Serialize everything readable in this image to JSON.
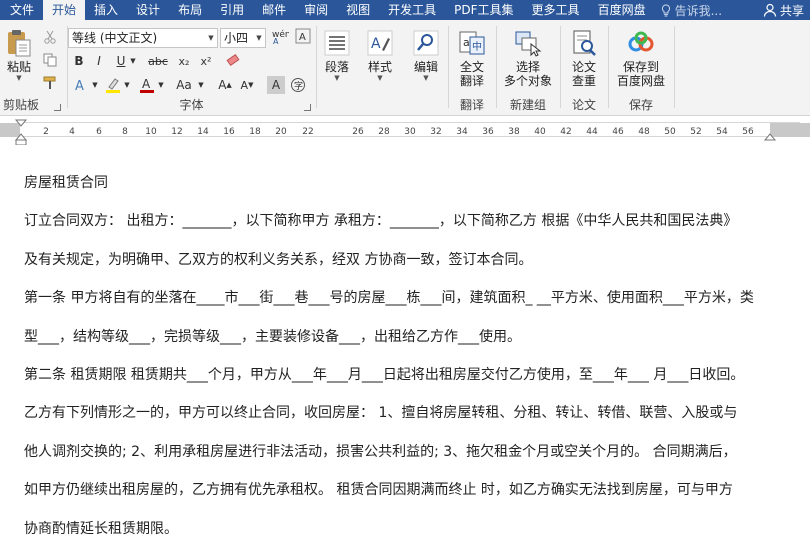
{
  "tabs": [
    "文件",
    "开始",
    "插入",
    "设计",
    "布局",
    "引用",
    "邮件",
    "审阅",
    "视图",
    "开发工具",
    "PDF工具集",
    "更多工具",
    "百度网盘"
  ],
  "active_tab": "开始",
  "tell_me": "告诉我...",
  "share": "共享",
  "clipboard": {
    "paste": "粘贴",
    "label": "剪贴板"
  },
  "font": {
    "name": "等线 (中文正文)",
    "size": "小四",
    "label": "字体"
  },
  "paragraph": {
    "label": "段落"
  },
  "styles": {
    "label": "样式"
  },
  "editing": {
    "label": "编辑"
  },
  "translate": {
    "btn_line1": "全文",
    "btn_line2": "翻译",
    "label": "翻译"
  },
  "newgroup": {
    "btn_line1": "选择",
    "btn_line2": "多个对象",
    "label": "新建组"
  },
  "thesis": {
    "btn_line1": "论文",
    "btn_line2": "查重",
    "label": "论文"
  },
  "save": {
    "btn_line1": "保存到",
    "btn_line2": "百度网盘",
    "label": "保存"
  },
  "ruler_ticks": [
    "2",
    "4",
    "6",
    "8",
    "10",
    "12",
    "14",
    "16",
    "18",
    "20",
    "22",
    "26",
    "28",
    "30",
    "32",
    "34",
    "36",
    "38",
    "40",
    "42",
    "44",
    "46",
    "48",
    "50",
    "52",
    "54",
    "56"
  ],
  "document_lines": [
    "房屋租赁合同",
    "订立合同双方：  出租方：_______，以下简称甲方  承租方：_______，以下简称乙方  根据《中华人民共和国民法典》",
    "及有关规定，为明确甲、乙双方的权利义务关系，经双  方协商一致，签订本合同。",
    "第一条  甲方将自有的坐落在____市___街___巷___号的房屋___栋___间，建筑面积_ __平方米、使用面积___平方米，类",
    "型___，结构等级___，完损等级___，主要装修设备___，出租给乙方作___使用。",
    "第二条  租赁期限  租赁期共___个月，甲方从___年___月___日起将出租房屋交付乙方使用，至___年___  月___日收回。",
    "乙方有下列情形之一的，甲方可以终止合同，收回房屋：  1、擅自将房屋转租、分租、转让、转借、联营、入股或与",
    "他人调剂交换的; 2、利用承租房屋进行非法活动，损害公共利益的; 3、拖欠租金个月或空关个月的。  合同期满后，",
    "如甲方仍继续出租房屋的，乙方拥有优先承租权。 租赁合同因期满而终止  时，如乙方确实无法找到房屋，可与甲方",
    "协商酌情延长租赁期限。"
  ]
}
